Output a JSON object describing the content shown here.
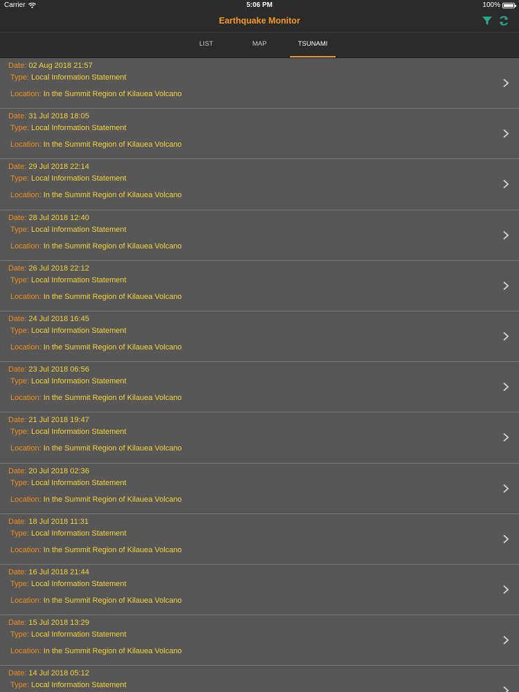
{
  "status_bar": {
    "carrier": "Carrier",
    "time": "5:06 PM",
    "battery": "100%"
  },
  "nav": {
    "title": "Earthquake Monitor",
    "actions": [
      "filter-icon",
      "refresh-icon"
    ],
    "accent": "#f59a1c",
    "icon_color": "#2aa88f"
  },
  "tabs": [
    {
      "label": "LIST",
      "active": false
    },
    {
      "label": "MAP",
      "active": false
    },
    {
      "label": "TSUNAMI",
      "active": true
    }
  ],
  "labels": {
    "date": "Date:",
    "type": "Type:",
    "location": "Location:"
  },
  "rows": [
    {
      "date": "02 Aug 2018 21:57",
      "type": "Local Information Statement",
      "location": "In the Summit Region of Kilauea Volcano"
    },
    {
      "date": "31 Jul 2018 18:05",
      "type": "Local Information Statement",
      "location": "In the Summit Region of Kilauea Volcano"
    },
    {
      "date": "29 Jul 2018 22:14",
      "type": "Local Information Statement",
      "location": "In the Summit Region of Kilauea Volcano"
    },
    {
      "date": "28 Jul 2018 12:40",
      "type": "Local Information Statement",
      "location": "In the Summit Region of Kilauea Volcano"
    },
    {
      "date": "26 Jul 2018 22:12",
      "type": "Local Information Statement",
      "location": "In the Summit Region of Kilauea Volcano"
    },
    {
      "date": "24 Jul 2018 16:45",
      "type": "Local Information Statement",
      "location": "In the Summit Region of Kilauea Volcano"
    },
    {
      "date": "23 Jul 2018 06:56",
      "type": "Local Information Statement",
      "location": "In the Summit Region of Kilauea Volcano"
    },
    {
      "date": "21 Jul 2018 19:47",
      "type": "Local Information Statement",
      "location": "In the Summit Region of Kilauea Volcano"
    },
    {
      "date": "20 Jul 2018 02:36",
      "type": "Local Information Statement",
      "location": "In the Summit Region of Kilauea Volcano"
    },
    {
      "date": "18 Jul 2018 11:31",
      "type": "Local Information Statement",
      "location": "In the Summit Region of Kilauea Volcano"
    },
    {
      "date": "16 Jul 2018 21:44",
      "type": "Local Information Statement",
      "location": "In the Summit Region of Kilauea Volcano"
    },
    {
      "date": "15 Jul 2018 13:29",
      "type": "Local Information Statement",
      "location": "In the Summit Region of Kilauea Volcano"
    },
    {
      "date": "14 Jul 2018 05:12",
      "type": "Local Information Statement",
      "location": ""
    }
  ]
}
